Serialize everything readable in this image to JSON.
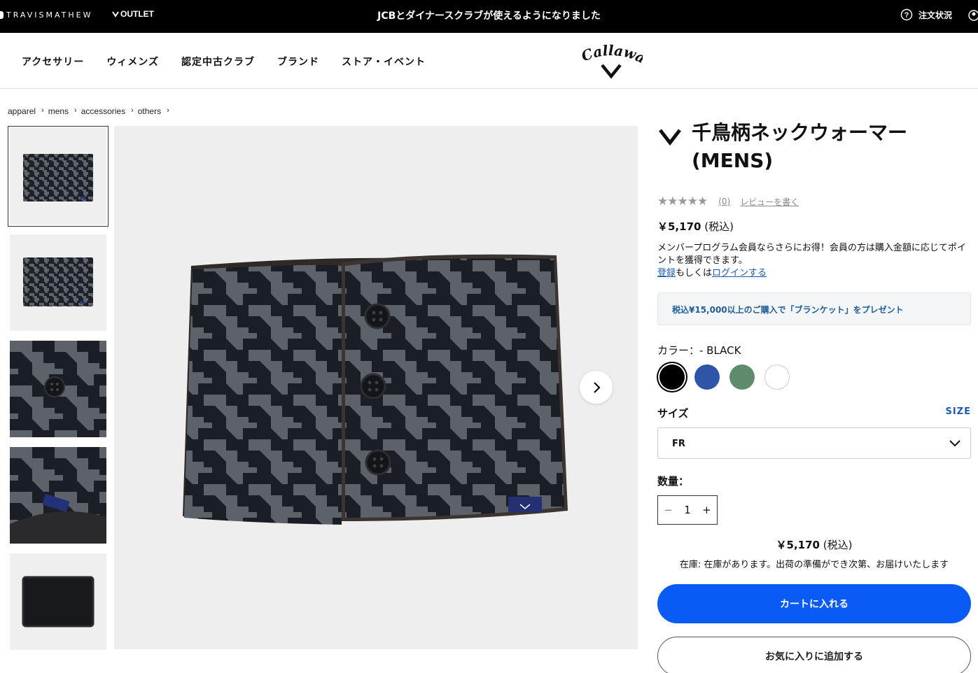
{
  "topbar": {
    "brand": "TRAVISMATHEW",
    "outlet": "OUTLET",
    "notice": "JCBとダイナースクラブが使えるようになりました",
    "orders": "注文状況"
  },
  "nav": {
    "items": [
      "アクセサリー",
      "ウィメンズ",
      "認定中古クラブ",
      "ブランド",
      "ストア・イベント"
    ]
  },
  "breadcrumb": [
    "apparel",
    "mens",
    "accessories",
    "others"
  ],
  "product": {
    "title": "千鳥柄ネックウォーマー (MENS)",
    "rating_stars": "★★★★★",
    "review_count": "(0)",
    "write_review": "レビューを書く",
    "price": "￥5,170",
    "tax": "(税込)",
    "member_text": "メンバープログラム会員ならさらにお得！会員の方は購入金額に応じてポイントを獲得できます。",
    "register_link": "登録",
    "or_text": "もしくは",
    "login_link": "ログインする",
    "promo": "税込¥15,000以上のご購入で「ブランケット」をプレゼント",
    "color_label": "カラー：- BLACK",
    "colors": [
      "#000000",
      "#2f55a8",
      "#5e8b6b",
      "#ffffff"
    ],
    "size_label": "サイズ",
    "size_link": "SIZE",
    "size_value": "FR",
    "qty_label": "数量：",
    "qty_value": "1",
    "price_bottom": "￥5,170",
    "tax_bottom": "(税込)",
    "stock": "在庫: 在庫があります。出荷の準備ができ次第、お届けいたします",
    "cart_button": "カートに入れる",
    "fav_button": "お気に入りに追加する"
  },
  "icons": {
    "help": "help-circle-icon",
    "user": "user-icon",
    "next": "chevron-right-icon"
  }
}
